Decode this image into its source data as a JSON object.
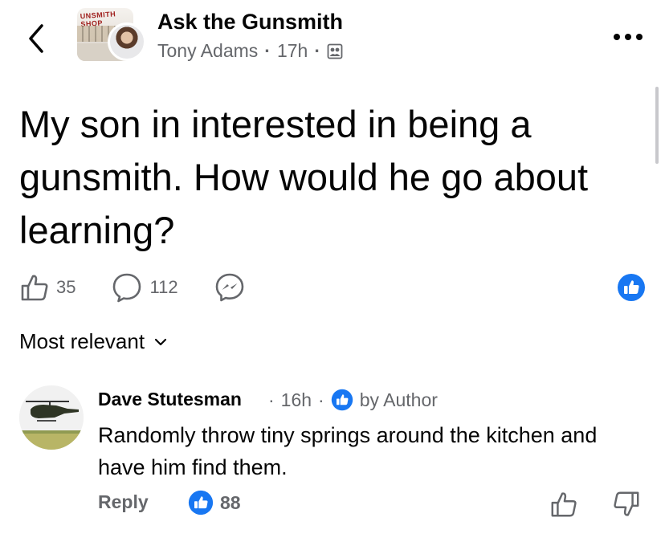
{
  "header": {
    "group_name": "Ask the Gunsmith",
    "author": "Tony Adams",
    "separator": "·",
    "time": "17h",
    "group_sign_text": "UNSMITH SHOP"
  },
  "post": {
    "text": "My son in interested in being a gunsmith. How would he go about learning?",
    "like_count": "35",
    "comment_count": "112"
  },
  "sort": {
    "label": "Most relevant"
  },
  "comment": {
    "author": "Dave Stutesman",
    "separator": "·",
    "time": "16h",
    "badge": "by Author",
    "text": "Randomly throw tiny springs around the kitchen and have him find them.",
    "reply_label": "Reply",
    "reaction_count": "88"
  },
  "colors": {
    "brand_blue": "#1877f2",
    "secondary_text": "#65676b",
    "primary_text": "#050505"
  },
  "icons": [
    "back-chevron-icon",
    "more-dots-icon",
    "group-icon",
    "like-outline-icon",
    "comment-icon",
    "messenger-icon",
    "like-badge-icon",
    "chevron-down-icon",
    "dislike-outline-icon"
  ]
}
